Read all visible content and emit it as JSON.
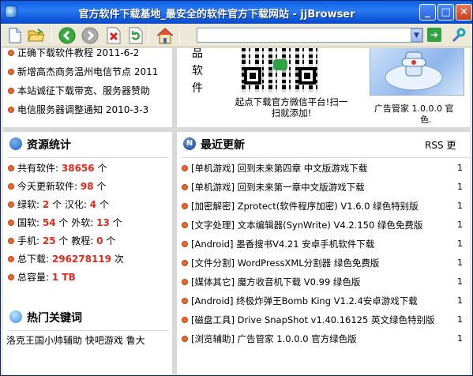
{
  "window": {
    "title": "官方软件下载基地_最安全的软件官方下载网站 - jjBrowser",
    "min_glyph": "_",
    "max_glyph": "□",
    "close_glyph": "✕"
  },
  "toolbar": {
    "address_value": "",
    "dropdown_glyph": "▼",
    "go_glyph": "➔",
    "icons": [
      "new-page-icon",
      "open-folder-icon",
      "back-icon",
      "forward-icon",
      "stop-icon",
      "refresh-icon",
      "home-icon",
      "go-icon",
      "tools-icon"
    ]
  },
  "news": [
    "正确下载软件教程 2011-6-2",
    "新增高杰商务温州电信节点 2011",
    "本站诚征下载带宽、服务器赞助",
    "电信服务器调整通知 2010-3-3"
  ],
  "promo": {
    "side_text_1": "品",
    "side_text_2": "软",
    "side_text_3": "件",
    "caption_line1": "起点下载官方微信平台!扫一",
    "caption_line2": "扫就添加!",
    "ad_caption_line1": "广告管家 1.0.0.0 官",
    "ad_caption_line2": "色."
  },
  "stats": {
    "title": "资源统计",
    "total_label": "共有软件:",
    "total_value": "38656",
    "total_unit": "个",
    "today_label": "今天更新软件:",
    "today_value": "98",
    "today_unit": "个",
    "green_label": "绿软:",
    "green_value": "2",
    "green_unit": "个",
    "hanhua_label": "汉化:",
    "hanhua_value": "4",
    "hanhua_unit": "个",
    "guo_label": "国软:",
    "guo_value": "54",
    "guo_unit": "个",
    "wai_label": "外软:",
    "wai_value": "13",
    "wai_unit": "个",
    "mobile_label": "手机:",
    "mobile_value": "25",
    "mobile_unit": "个",
    "tutorial_label": "教程:",
    "tutorial_value": "0",
    "tutorial_unit": "个",
    "downloads_label": "总下载:",
    "downloads_value": "296278119",
    "downloads_unit": "次",
    "capacity_label": "总容量:",
    "capacity_value": "1 TB"
  },
  "keywords": {
    "title": "热门关键词",
    "line": "洛克王国小帅辅助 快吧游戏 鲁大"
  },
  "updates": {
    "title": "最近更新",
    "rss": "RSS 更",
    "items": [
      "[单机游戏] 回到未来第四章 中文版游戏下载",
      "[单机游戏] 回到未来第一章中文版游戏下载",
      "[加密解密] Zprotect(软件程序加密) V1.6.0 绿色特别版",
      "[文字处理] 文本编辑器(SynWrite) V4.2.150 绿色免费版",
      "[Android] 墨香搜书V4.21 安卓手机软件下载",
      "[文件分割] WordPressXML分割器 绿色免费版",
      "[媒体其它] 魔方收音机下载 V0.99 绿色版",
      "[Android] 终极炸弹王Bomb King V1.2.4安卓游戏下载",
      "[磁盘工具] Drive SnapShot v1.40.16125 英文绿色特别版",
      "[浏览辅助] 广告管家 1.0.0.0 官方绿色版"
    ],
    "trailing_digit": "1"
  }
}
